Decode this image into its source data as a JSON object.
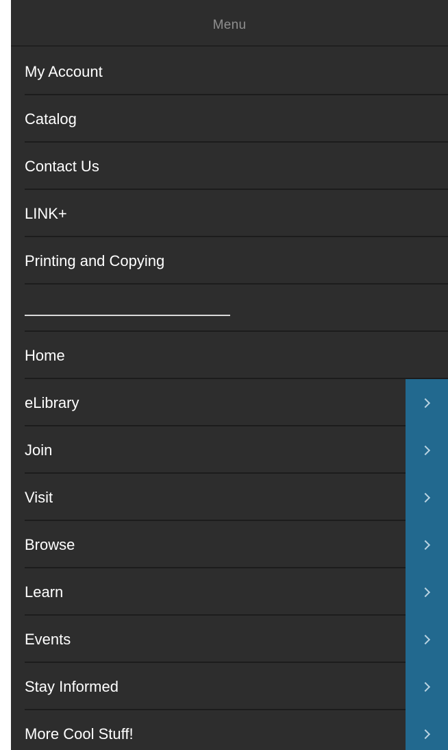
{
  "menu": {
    "title": "Menu",
    "primary_items": [
      {
        "label": "My Account"
      },
      {
        "label": "Catalog"
      },
      {
        "label": "Contact Us"
      },
      {
        "label": "LINK+"
      },
      {
        "label": "Printing and Copying"
      }
    ],
    "secondary_items": [
      {
        "label": "Home",
        "has_submenu": false
      },
      {
        "label": "eLibrary",
        "has_submenu": true
      },
      {
        "label": "Join",
        "has_submenu": true
      },
      {
        "label": "Visit",
        "has_submenu": true
      },
      {
        "label": "Browse",
        "has_submenu": true
      },
      {
        "label": "Learn",
        "has_submenu": true
      },
      {
        "label": "Events",
        "has_submenu": true
      },
      {
        "label": "Stay Informed",
        "has_submenu": true
      },
      {
        "label": "More Cool Stuff!",
        "has_submenu": true
      }
    ],
    "submenu_icon": "chevron-right-icon"
  },
  "colors": {
    "panel_background": "#2d2d2d",
    "header_text": "#8f8f8f",
    "item_text": "#ffffff",
    "submenu_toggle_background": "#22698f",
    "chevron": "#b9d3e2"
  }
}
